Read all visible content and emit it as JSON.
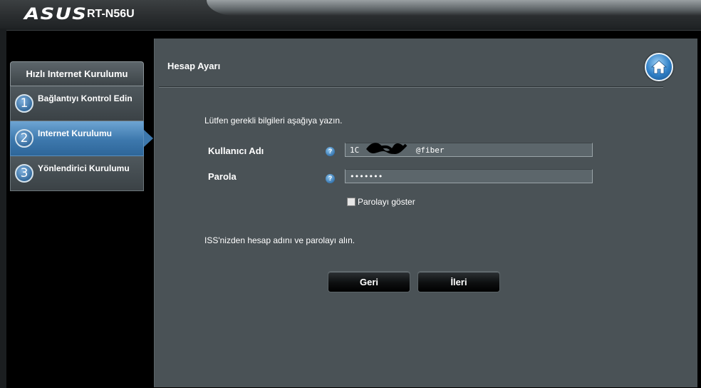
{
  "header": {
    "brand": "ASUS",
    "model": "RT-N56U"
  },
  "sidebar": {
    "title": "Hızlı Internet Kurulumu",
    "steps": [
      {
        "number": "1",
        "label": "Bağlantıyı Kontrol Edin"
      },
      {
        "number": "2",
        "label": "Internet Kurulumu"
      },
      {
        "number": "3",
        "label": "Yönlendirici Kurulumu"
      }
    ],
    "active_step": "2"
  },
  "panel": {
    "title": "Hesap Ayarı",
    "instruction": "Lütfen gerekli bilgileri aşağıya yazın.",
    "username": {
      "label": "Kullanıcı Adı",
      "value": "1C            @fiber"
    },
    "password": {
      "label": "Parola",
      "value": "•••••••"
    },
    "show_password_label": "Parolayı göster",
    "show_password_checked": false,
    "note": "ISS'nizden hesap adını ve parolayı alın.",
    "back_button": "Geri",
    "next_button": "İleri"
  },
  "icons": {
    "home": "home-icon",
    "help": "help-icon",
    "help_glyph": "?"
  },
  "colors": {
    "panel_bg": "#4a5256",
    "active_step": "#3d78ad",
    "input_bg": "#5c666b"
  }
}
